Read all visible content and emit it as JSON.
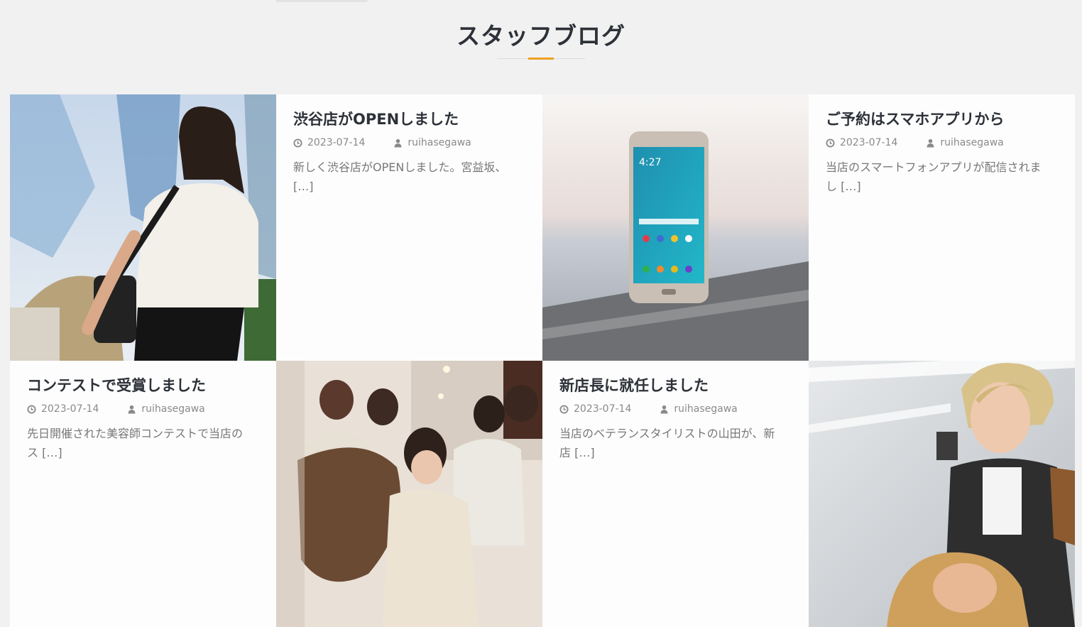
{
  "section": {
    "title": "スタッフブログ"
  },
  "colors": {
    "accent": "#f0a020",
    "title": "#2d3138",
    "meta": "#8a8a8a",
    "excerpt": "#777777",
    "background": "#f1f1f1",
    "card": "#fdfdfd"
  },
  "icons": {
    "date": "clock-icon",
    "author": "user-icon"
  },
  "posts": [
    {
      "title": "渋谷店がOPENしました",
      "date": "2023-07-14",
      "author": "ruihasegawa",
      "excerpt": "新しく渋谷店がOPENしました。宮益坂、 […]",
      "image": "businesswoman-photo"
    },
    {
      "title": "ご予約はスマホアプリから",
      "date": "2023-07-14",
      "author": "ruihasegawa",
      "excerpt": "当店のスマートフォンアプリが配信されまし […]",
      "image": "smartphone-photo"
    },
    {
      "title": "コンテストで受賞しました",
      "date": "2023-07-14",
      "author": "ruihasegawa",
      "excerpt": "先日開催された美容師コンテストで当店のス […]",
      "image": "salon-team-photo"
    },
    {
      "title": "新店長に就任しました",
      "date": "2023-07-14",
      "author": "ruihasegawa",
      "excerpt": "当店のベテランスタイリストの山田が、新店 […]",
      "image": "stylist-photo"
    }
  ]
}
